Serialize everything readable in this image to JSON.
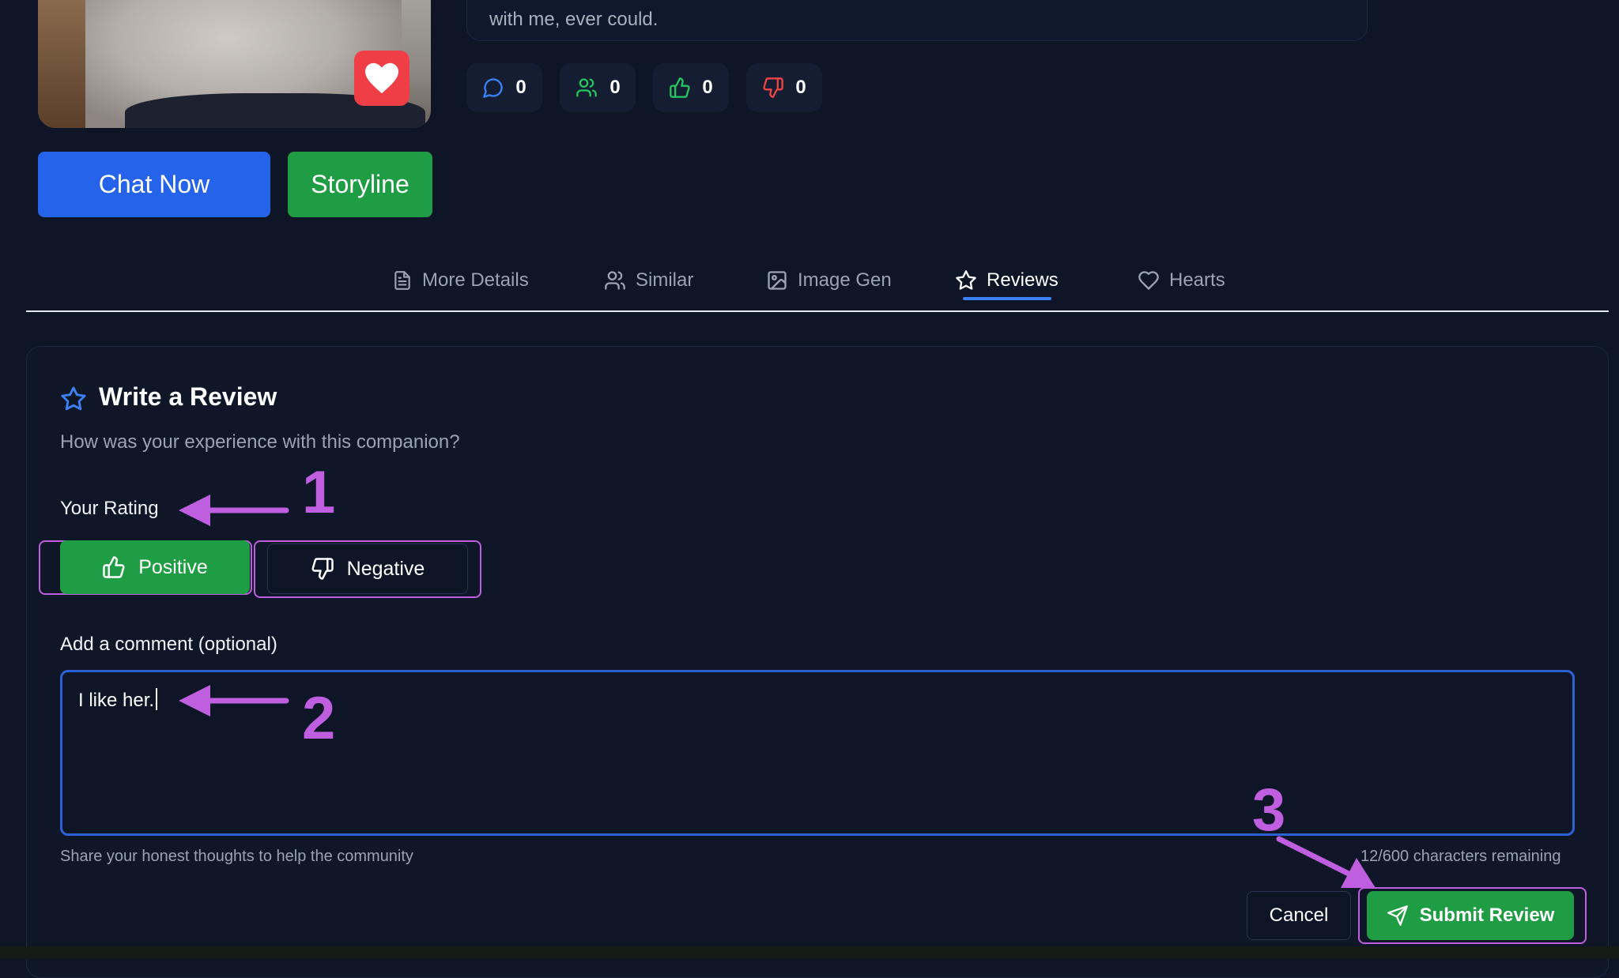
{
  "profile": {
    "description_tail": "with me, ever could.",
    "stats": [
      {
        "icon": "message-circle-icon",
        "value": "0",
        "color": "#3b82f6"
      },
      {
        "icon": "users-icon",
        "value": "0",
        "color": "#22c55e"
      },
      {
        "icon": "thumbs-up-icon",
        "value": "0",
        "color": "#22c55e"
      },
      {
        "icon": "thumbs-down-icon",
        "value": "0",
        "color": "#ef4444"
      }
    ],
    "chat_button": "Chat Now",
    "storyline_button": "Storyline"
  },
  "tabs": [
    {
      "label": "More Details",
      "icon": "file-text-icon"
    },
    {
      "label": "Similar",
      "icon": "users-icon"
    },
    {
      "label": "Image Gen",
      "icon": "image-icon"
    },
    {
      "label": "Reviews",
      "icon": "star-icon",
      "active": true
    },
    {
      "label": "Hearts",
      "icon": "heart-icon"
    }
  ],
  "review": {
    "title": "Write a Review",
    "subtitle": "How was your experience with this companion?",
    "rating_label": "Your Rating",
    "positive_label": "Positive",
    "negative_label": "Negative",
    "selected": "Positive",
    "comment_label": "Add a comment (optional)",
    "comment_value": "I like her.",
    "helper_text": "Share your honest thoughts to help the community",
    "chars_remaining": "12/600 characters remaining",
    "cancel_label": "Cancel",
    "submit_label": "Submit Review"
  },
  "annotations": [
    "1",
    "2",
    "3"
  ],
  "colors": {
    "background": "#0d1527",
    "primary_blue": "#2563eb",
    "green": "#1f9d44",
    "annotation_purple": "#c05ee0",
    "heart_red": "#ef3e46"
  }
}
